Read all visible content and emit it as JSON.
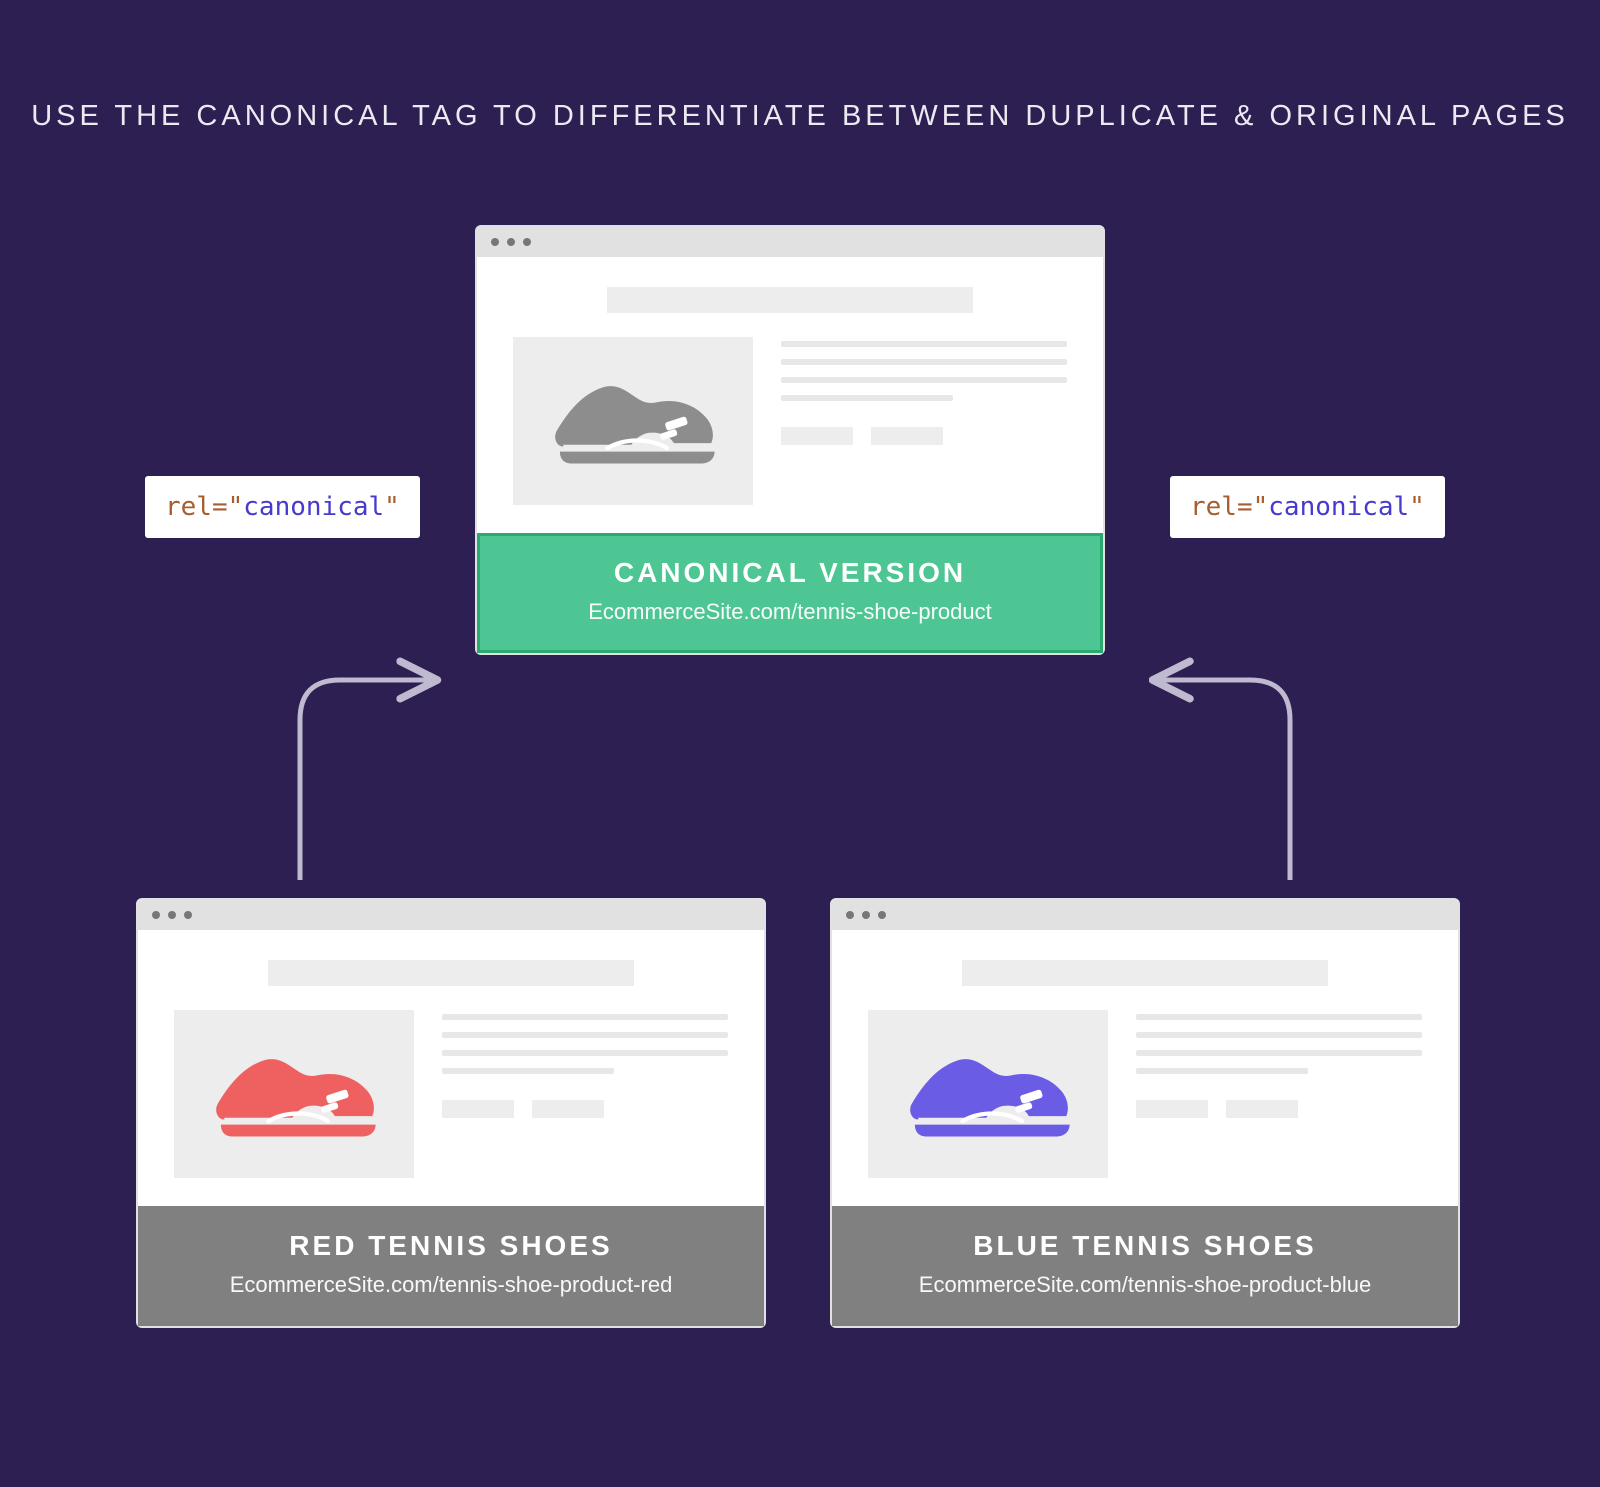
{
  "title": "USE THE CANONICAL TAG TO DIFFERENTIATE BETWEEN DUPLICATE & ORIGINAL PAGES",
  "codeTag": {
    "attr": "rel=",
    "quote": "\"",
    "value": "canonical"
  },
  "canonical": {
    "heading": "CANONICAL VERSION",
    "url": "EcommerceSite.com/tennis-shoe-product",
    "shoeColor": "#8d8d8d"
  },
  "variants": [
    {
      "heading": "RED TENNIS SHOES",
      "url": "EcommerceSite.com/tennis-shoe-product-red",
      "shoeColor": "#ef6161"
    },
    {
      "heading": "BLUE TENNIS SHOES",
      "url": "EcommerceSite.com/tennis-shoe-product-blue",
      "shoeColor": "#6b5ce6"
    }
  ]
}
